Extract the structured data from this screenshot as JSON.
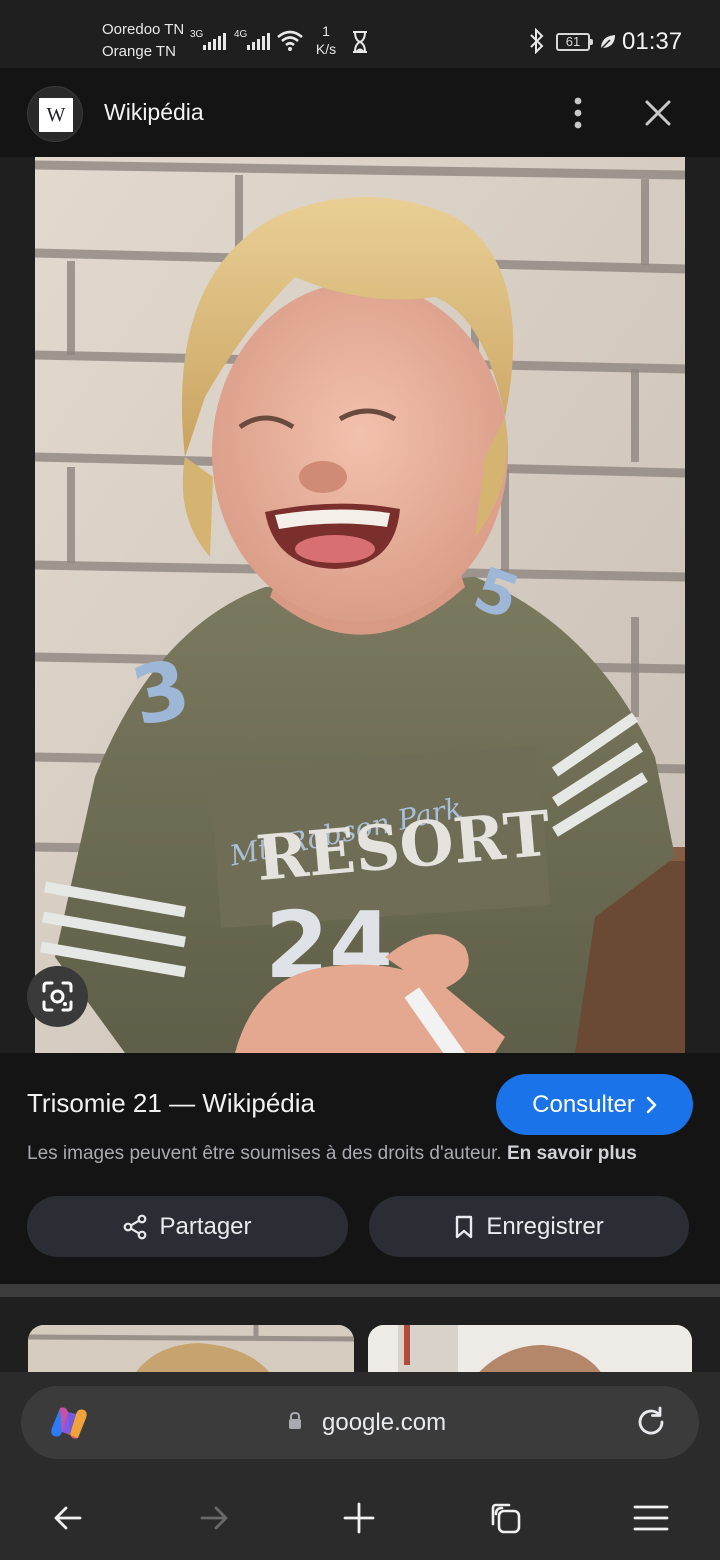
{
  "status": {
    "carrier1": "Ooredoo TN",
    "carrier2": "Orange TN",
    "net1": "3G",
    "net2": "4G",
    "speed_value": "1",
    "speed_unit": "K/s",
    "battery": "61",
    "time": "01:37"
  },
  "header": {
    "logo_letter": "W",
    "title": "Wikipédia"
  },
  "result": {
    "title": "Trisomie 21 — Wikipédia",
    "consult_label": "Consulter",
    "copyright_text": "Les images peuvent être soumises à des droits d'auteur.",
    "learn_more": "En savoir plus",
    "share_label": "Partager",
    "save_label": "Enregistrer"
  },
  "photo": {
    "shirt_line1": "Mt. Robson Park",
    "shirt_line2": "RESORT"
  },
  "address_bar": {
    "url": "google.com"
  },
  "icons": {
    "back": "arrow-left-icon",
    "forward": "arrow-right-icon",
    "new_tab": "plus-icon",
    "tabs": "tabs-icon",
    "menu": "hamburger-menu-icon"
  },
  "colors": {
    "accent": "#1a73e8",
    "background": "#1f1f1f",
    "panel": "#141414"
  }
}
